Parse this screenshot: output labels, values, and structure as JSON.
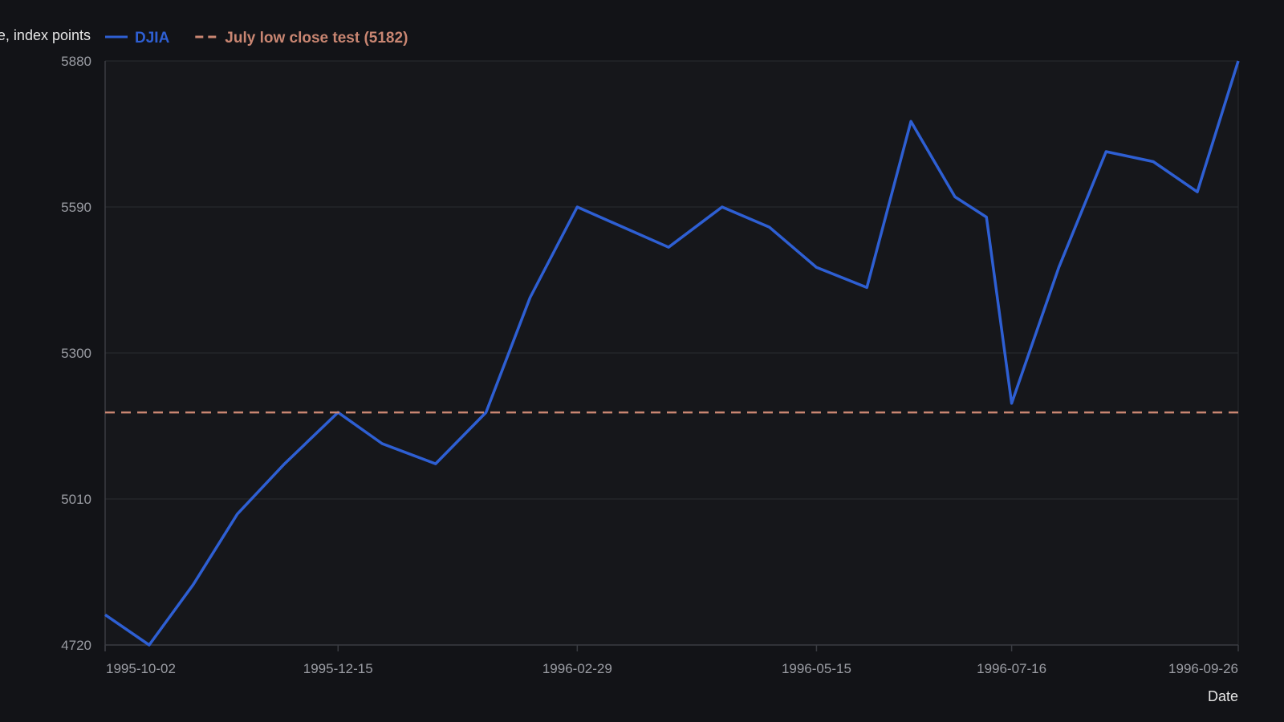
{
  "chart_data": {
    "type": "line",
    "title": "",
    "ylabel": "Close, index points",
    "xlabel": "Date",
    "ylim": [
      4720,
      5880
    ],
    "xlim": [
      "1995-10-02",
      "1996-09-26"
    ],
    "yticks": [
      "4720",
      "5010",
      "5300",
      "5590",
      "5880"
    ],
    "xticks": [
      "1995-10-02",
      "1995-12-15",
      "1996-02-29",
      "1996-05-15",
      "1996-07-16",
      "1996-09-26"
    ],
    "grid": true,
    "legend_position": "top-left",
    "series": [
      {
        "name": "DJIA",
        "color": "#2e5fd3",
        "style": "solid",
        "points": [
          {
            "x": "1995-10-02",
            "y": 4780
          },
          {
            "x": "1995-10-16",
            "y": 4720
          },
          {
            "x": "1995-10-30",
            "y": 4840
          },
          {
            "x": "1995-11-13",
            "y": 4980
          },
          {
            "x": "1995-11-28",
            "y": 5080
          },
          {
            "x": "1995-12-15",
            "y": 5182
          },
          {
            "x": "1995-12-29",
            "y": 5120
          },
          {
            "x": "1996-01-15",
            "y": 5080
          },
          {
            "x": "1996-01-31",
            "y": 5182
          },
          {
            "x": "1996-02-14",
            "y": 5410
          },
          {
            "x": "1996-02-29",
            "y": 5590
          },
          {
            "x": "1996-03-29",
            "y": 5510
          },
          {
            "x": "1996-04-15",
            "y": 5590
          },
          {
            "x": "1996-04-30",
            "y": 5550
          },
          {
            "x": "1996-05-15",
            "y": 5470
          },
          {
            "x": "1996-05-31",
            "y": 5430
          },
          {
            "x": "1996-06-14",
            "y": 5760
          },
          {
            "x": "1996-06-28",
            "y": 5610
          },
          {
            "x": "1996-07-08",
            "y": 5570
          },
          {
            "x": "1996-07-16",
            "y": 5200
          },
          {
            "x": "1996-07-31",
            "y": 5470
          },
          {
            "x": "1996-08-15",
            "y": 5700
          },
          {
            "x": "1996-08-30",
            "y": 5680
          },
          {
            "x": "1996-09-13",
            "y": 5620
          },
          {
            "x": "1996-09-26",
            "y": 5880
          }
        ]
      },
      {
        "name": "July low close test (5182)",
        "color": "#c98672",
        "style": "dashed",
        "points": [
          {
            "x": "1995-10-02",
            "y": 5182
          },
          {
            "x": "1996-09-26",
            "y": 5182
          }
        ]
      }
    ]
  },
  "colors": {
    "background": "#121317",
    "plot_background": "#16171b",
    "grid": "#2a2c31",
    "axis": "#3a3c42"
  }
}
